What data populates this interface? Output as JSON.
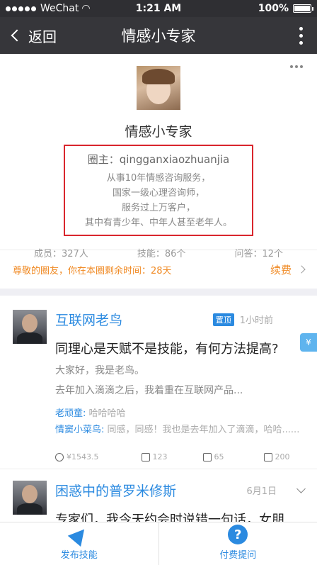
{
  "status": {
    "carrier": "WeChat",
    "time": "1:21 AM",
    "battery": "100%"
  },
  "nav": {
    "back_label": "返回",
    "title": "情感小专家"
  },
  "profile": {
    "name": "情感小专家",
    "owner": "圈主：qingganxiaozhuanjia",
    "desc": [
      "从事10年情感咨询服务，",
      "国家一级心理咨询师，",
      "服务过上万客户，",
      "其中有青少年、中年人甚至老年人。"
    ],
    "stats": {
      "members": "成员：327人",
      "skills": "技能：86个",
      "qa": "问答：12个"
    }
  },
  "renew": {
    "notice": "尊敬的圈友，你在本圈剩余时间：28天",
    "button": "续费"
  },
  "post1": {
    "author": "互联网老鸟",
    "tag": "置顶",
    "time": "1小时前",
    "title": "同理心是天赋不是技能，有何方法提高?",
    "lines": [
      "大家好，我是老鸟。",
      "去年加入滴滴之后，我着重在互联网产品..."
    ],
    "comments": [
      {
        "who": "老顽童:",
        "text": "哈哈哈哈"
      },
      {
        "who": "情窦小菜鸟:",
        "text": "同感，同感！我也是去年加入了滴滴，哈哈......"
      }
    ],
    "actions": {
      "reward": "¥1543.5",
      "likes": "123",
      "comments": "65",
      "shares": "200"
    },
    "side_badge": "¥"
  },
  "post2": {
    "author": "困惑中的普罗米修斯",
    "time": "6月1日",
    "title": "专家们，我今天约会时说错一句话，女朋"
  },
  "tabs": {
    "publish": "发布技能",
    "ask": "付费提问",
    "ask_icon": "?"
  },
  "colors": {
    "accent": "#2b8ae0",
    "orange": "#f08a24",
    "highlight": "#d9262d"
  }
}
